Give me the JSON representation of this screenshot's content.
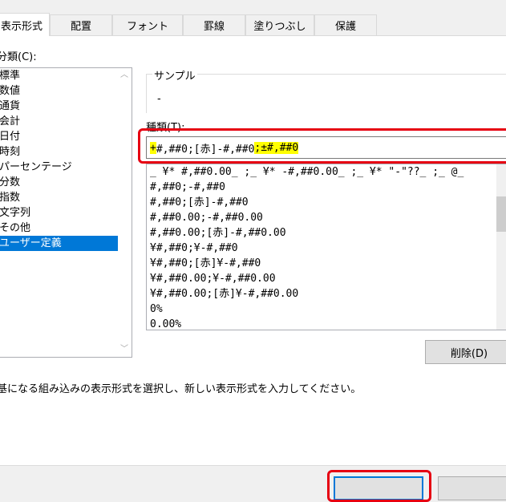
{
  "tabs": [
    {
      "label": "表示形式",
      "active": true
    },
    {
      "label": "配置"
    },
    {
      "label": "フォント"
    },
    {
      "label": "罫線"
    },
    {
      "label": "塗りつぶし"
    },
    {
      "label": "保護"
    }
  ],
  "category": {
    "label": "分類(C):",
    "items": [
      "標準",
      "数値",
      "通貨",
      "会計",
      "日付",
      "時刻",
      "パーセンテージ",
      "分数",
      "指数",
      "文字列",
      "その他",
      "ユーザー定義"
    ],
    "selected_index": 11
  },
  "sample": {
    "title": "サンプル",
    "value": "-"
  },
  "type": {
    "label": "種類(T):",
    "value_parts": [
      {
        "text": "+",
        "highlight": true
      },
      {
        "text": "#,##0;[赤]-#,##0",
        "highlight": false
      },
      {
        "text": ";±#,##0",
        "highlight": true
      }
    ]
  },
  "format_list": [
    "_ ¥* #,##0.00_ ;_ ¥* -#,##0.00_ ;_ ¥* \"-\"??_ ;_ @_",
    "#,##0;-#,##0",
    "#,##0;[赤]-#,##0",
    "#,##0.00;-#,##0.00",
    "#,##0.00;[赤]-#,##0.00",
    "¥#,##0;¥-#,##0",
    "¥#,##0;[赤]¥-#,##0",
    "¥#,##0.00;¥-#,##0.00",
    "¥#,##0.00;[赤]¥-#,##0.00",
    "0%",
    "0.00%"
  ],
  "delete_button": "削除(D)",
  "description": "基になる組み込みの表示形式を選択し、新しい表示形式を入力してください。",
  "colors": {
    "highlight": "#ffff00",
    "annotation_red": "#e60012",
    "selection_blue": "#0078d7"
  }
}
